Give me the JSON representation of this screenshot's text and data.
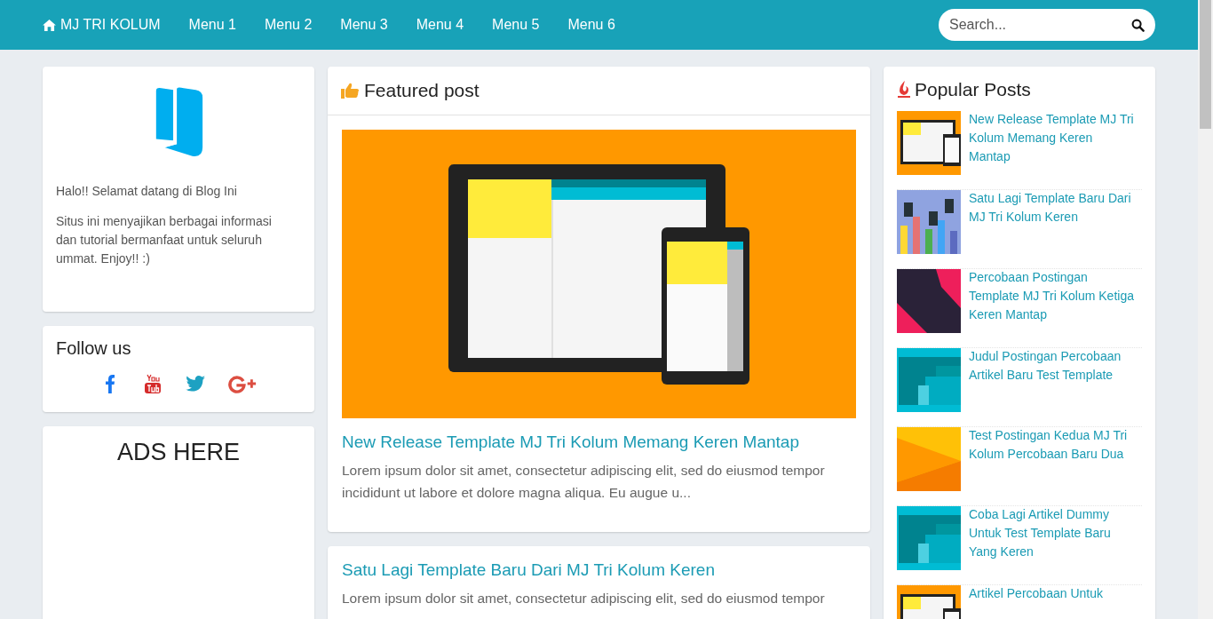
{
  "navbar": {
    "brand": "MJ TRI KOLUM",
    "menu": [
      {
        "label": "Menu 1"
      },
      {
        "label": "Menu 2"
      },
      {
        "label": "Menu 3"
      },
      {
        "label": "Menu 4"
      },
      {
        "label": "Menu 5"
      },
      {
        "label": "Menu 6"
      }
    ],
    "search": {
      "placeholder": "Search..."
    }
  },
  "profile": {
    "greeting": "Halo!! Selamat datang di Blog Ini",
    "description": "Situs ini menyajikan berbagai informasi dan tutorial bermanfaat untuk seluruh ummat. Enjoy!! :)"
  },
  "follow": {
    "title": "Follow us",
    "networks": [
      {
        "kind": "facebook"
      },
      {
        "kind": "youtube"
      },
      {
        "kind": "twitter"
      },
      {
        "kind": "googleplus"
      }
    ]
  },
  "ads": {
    "title": "ADS HERE"
  },
  "featured": {
    "title": "Featured post",
    "posts": [
      {
        "title": "New Release Template MJ Tri Kolum Memang Keren Mantap",
        "excerpt": "Lorem ipsum dolor sit amet, consectetur adipiscing elit, sed do eiusmod tempor incididunt ut labore et dolore magna aliqua. Eu augue u..."
      },
      {
        "title": "Satu Lagi Template Baru Dari MJ Tri Kolum Keren",
        "excerpt": "Lorem ipsum dolor sit amet, consectetur adipiscing elit, sed do eiusmod tempor"
      }
    ]
  },
  "popular": {
    "title": "Popular Posts",
    "posts": [
      {
        "title": "New Release Template MJ Tri Kolum Memang Keren Mantap"
      },
      {
        "title": "Satu Lagi Template Baru Dari MJ Tri Kolum Keren"
      },
      {
        "title": "Percobaan Postingan Template MJ Tri Kolum Ketiga Keren Mantap"
      },
      {
        "title": "Judul Postingan Percobaan Artikel Baru Test Template"
      },
      {
        "title": "Test Postingan Kedua MJ Tri Kolum Percobaan Baru Dua"
      },
      {
        "title": "Coba Lagi Artikel Dummy Untuk Test Template Baru Yang Keren"
      },
      {
        "title": "Artikel Percobaan Untuk"
      }
    ]
  }
}
